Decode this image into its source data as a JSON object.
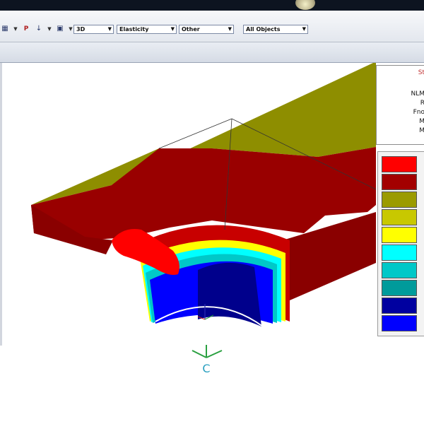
{
  "toolbar": {
    "icons": [
      "grid-icon",
      "probe-icon",
      "arrow-icon",
      "mesh-icon",
      "camera-icon"
    ],
    "p_label": "P",
    "dropdowns": [
      {
        "name": "view-mode-select",
        "value": "3D"
      },
      {
        "name": "result-type-select",
        "value": "Elasticity"
      },
      {
        "name": "component-select",
        "value": "Other"
      },
      {
        "name": "object-filter-select",
        "value": "All Objects"
      }
    ]
  },
  "info_panel": {
    "lines": [
      "St",
      "NLM",
      "R",
      "Fno",
      "M",
      "M"
    ]
  },
  "legend": {
    "colors": [
      "#ff0000",
      "#a30000",
      "#9b9b00",
      "#c8c800",
      "#ffff00",
      "#00ffff",
      "#00c8c8",
      "#009b9b",
      "#0000a0",
      "#0000ff"
    ]
  },
  "model": {
    "colors": {
      "top_olive": "#8e8e00",
      "dark_red": "#990000",
      "bright_red": "#ff0000",
      "blue": "#0000ff",
      "dark_blue": "#00008c"
    }
  },
  "triad": {
    "label": "C",
    "color": "#2aa040"
  }
}
